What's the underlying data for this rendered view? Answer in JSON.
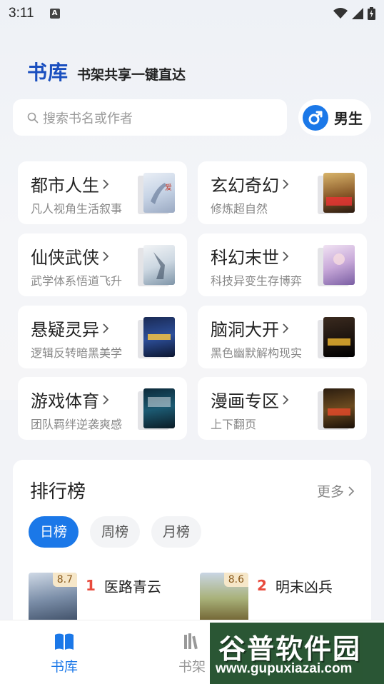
{
  "status": {
    "time": "3:11",
    "ime_icon_label": "A"
  },
  "header": {
    "title": "书库",
    "subtitle": "书架共享一键直达"
  },
  "search": {
    "placeholder": "搜索书名或作者"
  },
  "gender": {
    "label": "男生",
    "icon": "male-symbol-icon",
    "accent": "#1b78e8"
  },
  "categories": [
    {
      "title": "都市人生",
      "desc": "凡人视角生活叙事"
    },
    {
      "title": "玄幻奇幻",
      "desc": "修炼超自然"
    },
    {
      "title": "仙侠武侠",
      "desc": "武学体系悟道飞升"
    },
    {
      "title": "科幻末世",
      "desc": "科技异变生存博弈"
    },
    {
      "title": "悬疑灵异",
      "desc": "逻辑反转暗黑美学"
    },
    {
      "title": "脑洞大开",
      "desc": "黑色幽默解构现实"
    },
    {
      "title": "游戏体育",
      "desc": "团队羁绊逆袭爽感"
    },
    {
      "title": "漫画专区",
      "desc": "上下翻页"
    }
  ],
  "ranking": {
    "title": "排行榜",
    "more": "更多",
    "tabs": [
      "日榜",
      "周榜",
      "月榜"
    ],
    "active_tab": "日榜",
    "items": [
      {
        "rank": "1",
        "name": "医路青云",
        "score": "8.7"
      },
      {
        "rank": "2",
        "name": "明末凶兵",
        "score": "8.6"
      }
    ]
  },
  "nav": {
    "items": [
      "书库",
      "书架"
    ],
    "active": "书库"
  },
  "watermark": {
    "text": "谷普软件园",
    "url": "www.gupuxiazai.com"
  },
  "colors": {
    "brand": "#1a4fbf",
    "accent": "#1b78e8",
    "rank_number": "#e84a3c"
  }
}
